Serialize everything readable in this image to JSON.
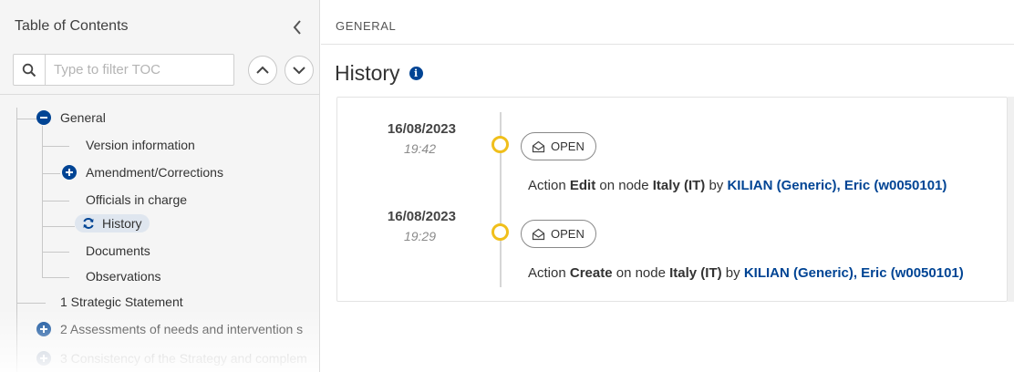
{
  "sidebar": {
    "title": "Table of Contents",
    "search_placeholder": "Type to filter TOC",
    "search_value": "",
    "tree": {
      "general": "General",
      "version_information": "Version information",
      "amendment_corrections": "Amendment/Corrections",
      "officials_in_charge": "Officials in charge",
      "history": "History",
      "documents": "Documents",
      "observations": "Observations",
      "strategic_statement": "1 Strategic Statement",
      "assessments": "2 Assessments of needs and intervention s",
      "consistency": "3 Consistency of the Strategy and complem"
    }
  },
  "breadcrumb": "GENERAL",
  "page_title": "History",
  "history": [
    {
      "date": "16/08/2023",
      "time": "19:42",
      "badge": "OPEN",
      "prefix": "Action ",
      "action": "Edit",
      "mid": " on node ",
      "node": "Italy (IT)",
      "by": " by ",
      "user": "KILIAN (Generic), Eric (w0050101)"
    },
    {
      "date": "16/08/2023",
      "time": "19:29",
      "badge": "OPEN",
      "prefix": "Action ",
      "action": "Create",
      "mid": " on node ",
      "node": "Italy (IT)",
      "by": " by ",
      "user": "KILIAN (Generic), Eric (w0050101)"
    }
  ],
  "colors": {
    "accent": "#004494",
    "timeline_dot": "#f0bf1b",
    "active_item_bg": "#dfe6ef"
  },
  "icons": {
    "collapse": "chevron-left-icon",
    "search": "search-icon",
    "nav_up": "chevron-up-icon",
    "nav_down": "chevron-down-icon",
    "expanded": "minus-circle-icon",
    "collapsed": "plus-circle-icon",
    "history": "refresh-icon",
    "info": "info-icon",
    "badge": "envelope-open-icon"
  }
}
